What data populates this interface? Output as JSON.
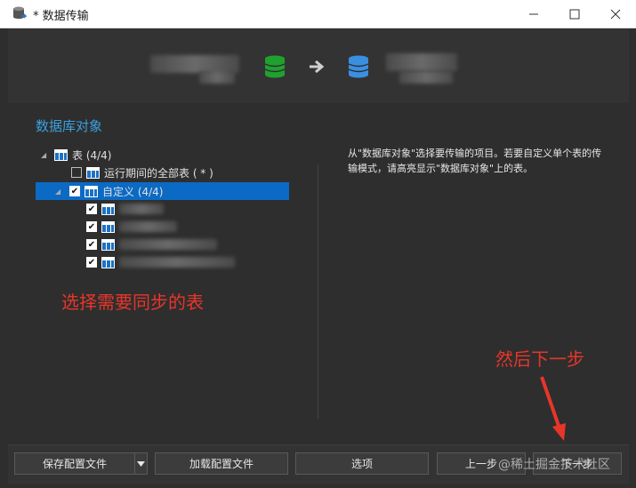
{
  "window": {
    "title": "* 数据传输"
  },
  "section": {
    "title": "数据库对象"
  },
  "tree": {
    "root_label": "表 (4/4)",
    "all_tables_label": "运行期间的全部表 ( * )",
    "custom_label": "自定义 (4/4)"
  },
  "description": "从\"数据库对象\"选择要传输的项目。若要自定义单个表的传输模式，请高亮显示\"数据库对象\"上的表。",
  "annotations": {
    "select_tables": "选择需要同步的表",
    "next_step": "然后下一步"
  },
  "buttons": {
    "save_config": "保存配置文件",
    "load_config": "加载配置文件",
    "options": "选项",
    "prev": "上一步",
    "next": "下一步"
  },
  "watermark": "@稀土掘金技术社区",
  "colors": {
    "accent": "#3aa0e0",
    "selection": "#0b6ac4",
    "annotation": "#e8352a",
    "db_source": "#1fa12f",
    "db_target": "#3b8fe0"
  }
}
